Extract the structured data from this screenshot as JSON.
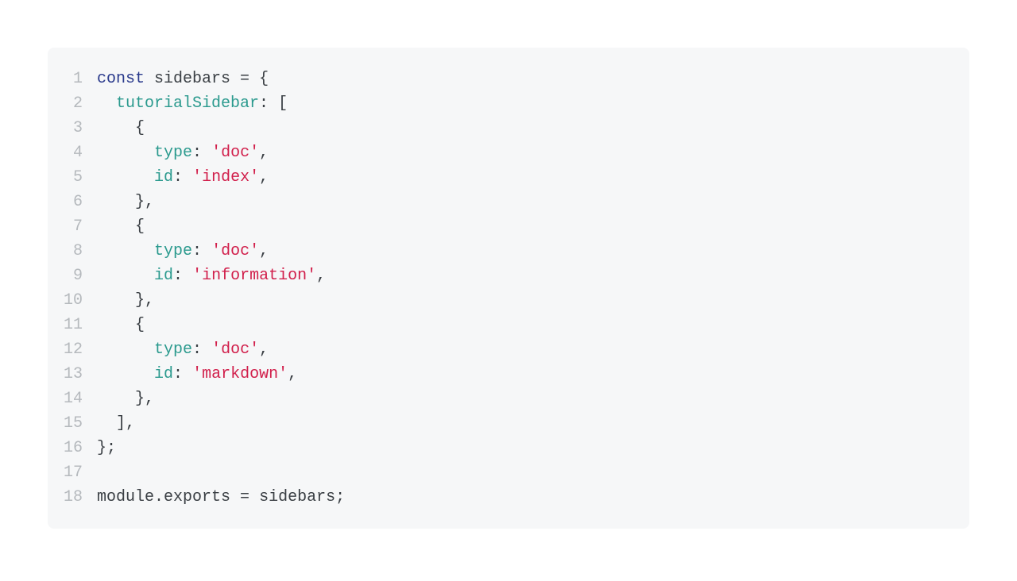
{
  "code": {
    "lines": [
      {
        "num": "1",
        "tokens": [
          {
            "cls": "tok-keyword",
            "text": "const"
          },
          {
            "cls": "tok-plain",
            "text": " sidebars "
          },
          {
            "cls": "tok-punct",
            "text": "="
          },
          {
            "cls": "tok-plain",
            "text": " "
          },
          {
            "cls": "tok-punct",
            "text": "{"
          }
        ]
      },
      {
        "num": "2",
        "tokens": [
          {
            "cls": "tok-plain",
            "text": "  "
          },
          {
            "cls": "tok-prop",
            "text": "tutorialSidebar"
          },
          {
            "cls": "tok-punct",
            "text": ":"
          },
          {
            "cls": "tok-plain",
            "text": " "
          },
          {
            "cls": "tok-punct",
            "text": "["
          }
        ]
      },
      {
        "num": "3",
        "tokens": [
          {
            "cls": "tok-plain",
            "text": "    "
          },
          {
            "cls": "tok-punct",
            "text": "{"
          }
        ]
      },
      {
        "num": "4",
        "tokens": [
          {
            "cls": "tok-plain",
            "text": "      "
          },
          {
            "cls": "tok-prop",
            "text": "type"
          },
          {
            "cls": "tok-punct",
            "text": ":"
          },
          {
            "cls": "tok-plain",
            "text": " "
          },
          {
            "cls": "tok-string",
            "text": "'doc'"
          },
          {
            "cls": "tok-punct",
            "text": ","
          }
        ]
      },
      {
        "num": "5",
        "tokens": [
          {
            "cls": "tok-plain",
            "text": "      "
          },
          {
            "cls": "tok-prop",
            "text": "id"
          },
          {
            "cls": "tok-punct",
            "text": ":"
          },
          {
            "cls": "tok-plain",
            "text": " "
          },
          {
            "cls": "tok-string",
            "text": "'index'"
          },
          {
            "cls": "tok-punct",
            "text": ","
          }
        ]
      },
      {
        "num": "6",
        "tokens": [
          {
            "cls": "tok-plain",
            "text": "    "
          },
          {
            "cls": "tok-punct",
            "text": "},"
          }
        ]
      },
      {
        "num": "7",
        "tokens": [
          {
            "cls": "tok-plain",
            "text": "    "
          },
          {
            "cls": "tok-punct",
            "text": "{"
          }
        ]
      },
      {
        "num": "8",
        "tokens": [
          {
            "cls": "tok-plain",
            "text": "      "
          },
          {
            "cls": "tok-prop",
            "text": "type"
          },
          {
            "cls": "tok-punct",
            "text": ":"
          },
          {
            "cls": "tok-plain",
            "text": " "
          },
          {
            "cls": "tok-string",
            "text": "'doc'"
          },
          {
            "cls": "tok-punct",
            "text": ","
          }
        ]
      },
      {
        "num": "9",
        "tokens": [
          {
            "cls": "tok-plain",
            "text": "      "
          },
          {
            "cls": "tok-prop",
            "text": "id"
          },
          {
            "cls": "tok-punct",
            "text": ":"
          },
          {
            "cls": "tok-plain",
            "text": " "
          },
          {
            "cls": "tok-string",
            "text": "'information'"
          },
          {
            "cls": "tok-punct",
            "text": ","
          }
        ]
      },
      {
        "num": "10",
        "tokens": [
          {
            "cls": "tok-plain",
            "text": "    "
          },
          {
            "cls": "tok-punct",
            "text": "},"
          }
        ]
      },
      {
        "num": "11",
        "tokens": [
          {
            "cls": "tok-plain",
            "text": "    "
          },
          {
            "cls": "tok-punct",
            "text": "{"
          }
        ]
      },
      {
        "num": "12",
        "tokens": [
          {
            "cls": "tok-plain",
            "text": "      "
          },
          {
            "cls": "tok-prop",
            "text": "type"
          },
          {
            "cls": "tok-punct",
            "text": ":"
          },
          {
            "cls": "tok-plain",
            "text": " "
          },
          {
            "cls": "tok-string",
            "text": "'doc'"
          },
          {
            "cls": "tok-punct",
            "text": ","
          }
        ]
      },
      {
        "num": "13",
        "tokens": [
          {
            "cls": "tok-plain",
            "text": "      "
          },
          {
            "cls": "tok-prop",
            "text": "id"
          },
          {
            "cls": "tok-punct",
            "text": ":"
          },
          {
            "cls": "tok-plain",
            "text": " "
          },
          {
            "cls": "tok-string",
            "text": "'markdown'"
          },
          {
            "cls": "tok-punct",
            "text": ","
          }
        ]
      },
      {
        "num": "14",
        "tokens": [
          {
            "cls": "tok-plain",
            "text": "    "
          },
          {
            "cls": "tok-punct",
            "text": "},"
          }
        ]
      },
      {
        "num": "15",
        "tokens": [
          {
            "cls": "tok-plain",
            "text": "  "
          },
          {
            "cls": "tok-punct",
            "text": "],"
          }
        ]
      },
      {
        "num": "16",
        "tokens": [
          {
            "cls": "tok-punct",
            "text": "};"
          }
        ]
      },
      {
        "num": "17",
        "tokens": [
          {
            "cls": "tok-plain",
            "text": ""
          }
        ]
      },
      {
        "num": "18",
        "tokens": [
          {
            "cls": "tok-plain",
            "text": "module"
          },
          {
            "cls": "tok-punct",
            "text": "."
          },
          {
            "cls": "tok-plain",
            "text": "exports "
          },
          {
            "cls": "tok-punct",
            "text": "="
          },
          {
            "cls": "tok-plain",
            "text": " sidebars"
          },
          {
            "cls": "tok-punct",
            "text": ";"
          }
        ]
      }
    ]
  }
}
